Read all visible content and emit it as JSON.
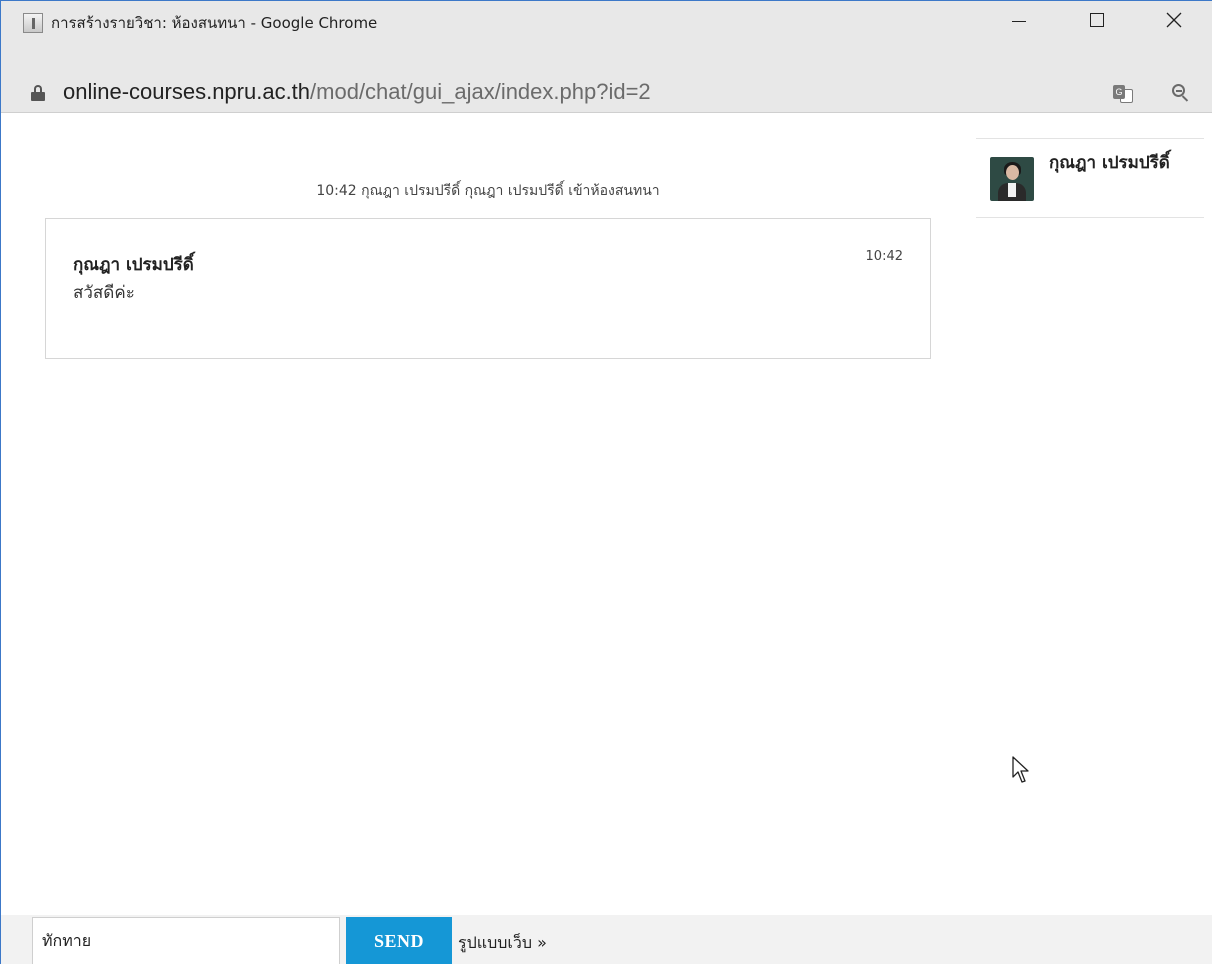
{
  "window": {
    "title": "การสร้างรายวิชา: ห้องสนทนา - Google Chrome",
    "minimize_icon": "minimize-icon",
    "maximize_icon": "maximize-icon",
    "close_icon": "close-icon"
  },
  "address_bar": {
    "host": "online-courses.npru.ac.th",
    "path": "/mod/chat/gui_ajax/index.php?id=2",
    "lock_icon": "lock-icon",
    "translate_icon": "translate-icon",
    "zoom_icon": "zoom-out-icon"
  },
  "chat": {
    "system_message": "10:42 กุณฎา เปรมปรีดิ์ กุณฎา เปรมปรีดิ์ เข้าห้องสนทนา",
    "messages": [
      {
        "author": "กุณฎา เปรมปรีดิ์",
        "text": "สวัสดีค่ะ",
        "time": "10:42"
      }
    ]
  },
  "users": [
    {
      "name": "กุณฎา เปรมปรีดิ์",
      "avatar_icon": "user-avatar"
    }
  ],
  "composer": {
    "input_value": "ทักทาย",
    "send_label": "SEND",
    "web_mode_label": "รูปแบบเว็บ »"
  },
  "colors": {
    "send_button": "#1597d6",
    "chrome_frame": "#e8e8e8",
    "window_border": "#3c78c8"
  }
}
